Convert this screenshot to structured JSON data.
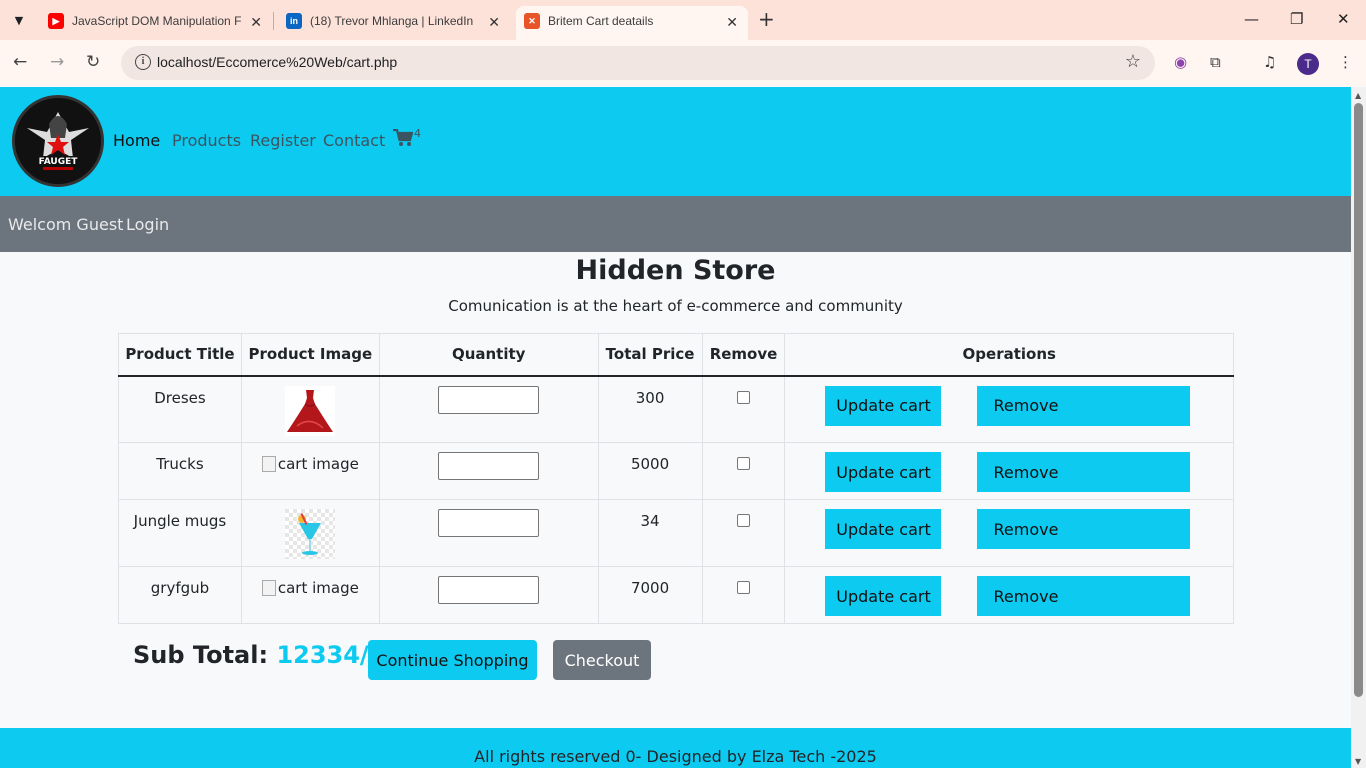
{
  "browser": {
    "tabs": [
      {
        "title": "JavaScript DOM Manipulation F",
        "icon": "youtube-icon",
        "color": "#ff0000"
      },
      {
        "title": "(18) Trevor Mhlanga | LinkedIn",
        "icon": "linkedin-icon",
        "color": "#0a66c2"
      },
      {
        "title": "Britem Cart deatails",
        "icon": "xampp-icon",
        "color": "#e8542a"
      }
    ],
    "url_host": "localhost",
    "url_path": "/Eccomerce%20Web/cart.php",
    "profile_initial": "T"
  },
  "site": {
    "nav": {
      "items": [
        "Home",
        "Products",
        "Register",
        "Contact"
      ],
      "cart_count": "4"
    },
    "logo_text": "FAUGET",
    "subnav": {
      "welcome": "Welcom Guest",
      "login": "Login"
    },
    "title": "Hidden Store",
    "subtitle": "Comunication is at the heart of e-commerce and community",
    "table": {
      "headers": [
        "Product Title",
        "Product Image",
        "Quantity",
        "Total Price",
        "Remove",
        "Operations"
      ],
      "rows": [
        {
          "title": "Dreses",
          "image": "dress-image",
          "price": "300"
        },
        {
          "title": "Trucks",
          "image_alt": "cart image",
          "price": "5000"
        },
        {
          "title": "Jungle mugs",
          "image": "drink-image",
          "price": "34"
        },
        {
          "title": "gryfgub",
          "image_alt": "cart image",
          "price": "7000"
        }
      ],
      "update_label": "Update cart",
      "remove_label": "Remove"
    },
    "subtotal_label": "Sub Total:",
    "subtotal_value": "12334/-",
    "continue_label": "Continue Shopping",
    "checkout_label": "Checkout",
    "footer": "All rights reserved 0- Designed by Elza Tech -2025",
    "accent": "#0dcaf0",
    "secondary": "#6c757d"
  }
}
